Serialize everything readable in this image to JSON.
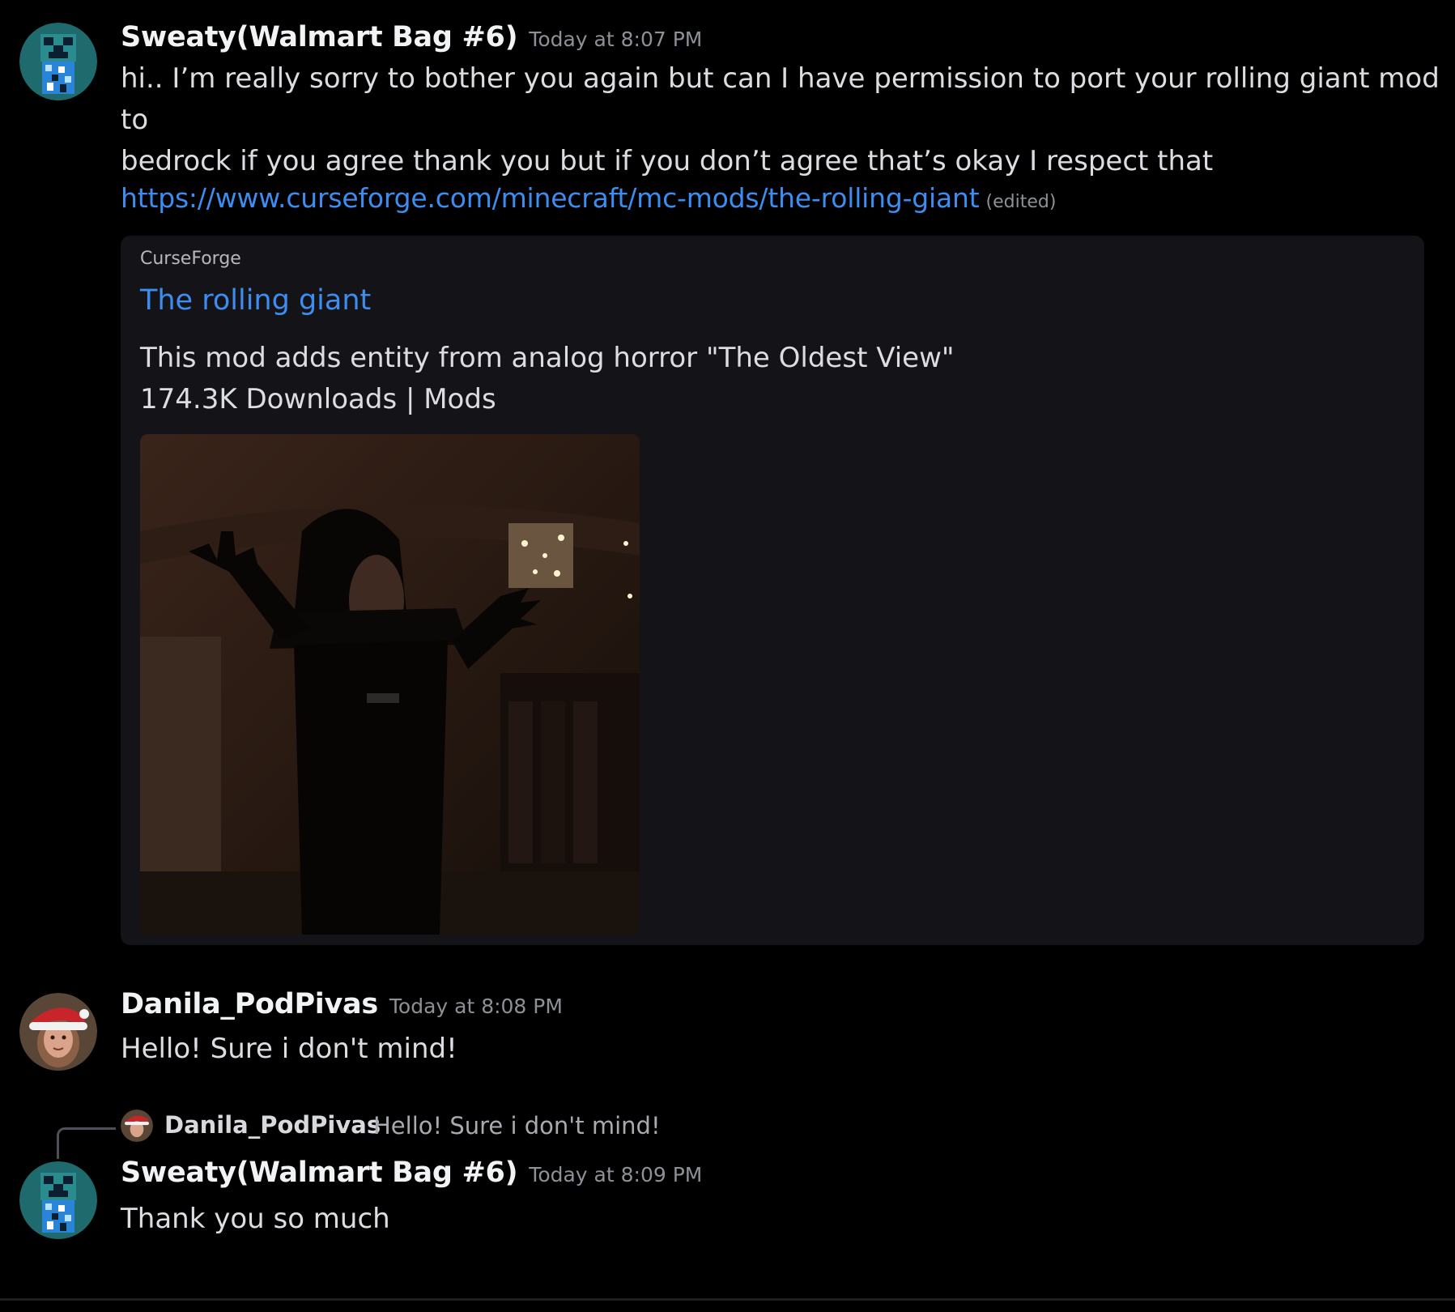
{
  "messages": [
    {
      "username": "Sweaty(Walmart Bag #6)",
      "timestamp": "Today at 8:07 PM",
      "text": "hi.. I’m really sorry to bother you again but can I have permission to port your rolling giant mod to\nbedrock if you agree thank you but if you don’t agree that’s okay I respect that",
      "link": "https://www.curseforge.com/minecraft/mc-mods/the-rolling-giant",
      "edited_label": "(edited)",
      "embed": {
        "provider": "CurseForge",
        "title": "The rolling giant",
        "description": "This mod adds entity from analog horror \"The Oldest View\"\n174.3K Downloads | Mods"
      }
    },
    {
      "username": "Danila_PodPivas",
      "timestamp": "Today at 8:08 PM",
      "text": "Hello! Sure i don't mind!"
    },
    {
      "reply_to": {
        "username": "Danila_PodPivas",
        "text": "Hello! Sure i don't mind!"
      },
      "username": "Sweaty(Walmart Bag #6)",
      "timestamp": "Today at 8:09 PM",
      "text": "Thank you so much"
    }
  ],
  "colors": {
    "background": "#000000",
    "link": "#3d8df0",
    "embed_background": "#141418",
    "timestamp": "#8e9097"
  },
  "icons": {
    "avatar_sweaty": "creeper-avatar-icon",
    "avatar_danila": "santa-hat-avatar-icon"
  }
}
